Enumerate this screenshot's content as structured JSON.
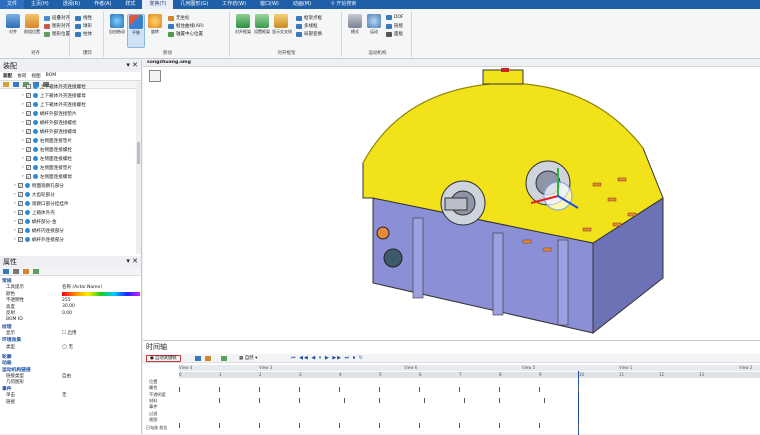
{
  "menu": {
    "file": "文件",
    "items": [
      "主页(H)",
      "透视(R)",
      "作者(A)",
      "样式",
      "变换(T)",
      "几何图形(G)",
      "工作坊(W)",
      "窗口(W)",
      "动画(M)"
    ],
    "search": "开始搜索"
  },
  "ribbon": {
    "g1": {
      "label": "对齐",
      "big": [
        "对齐",
        "前组位置"
      ],
      "small": [
        "层叠对齐",
        "图形对齐",
        "图形位置"
      ]
    },
    "g2": {
      "label": "爆炸",
      "small": [
        "线性",
        "球形",
        "柱体"
      ]
    },
    "g3": {
      "label": "移动",
      "big": [
        "自由拖动",
        "平移",
        "旋转"
      ],
      "small": [
        "无坐标",
        "框住曲线(AR)",
        "轴置中心位置"
      ]
    },
    "g4": {
      "label": "对开框架",
      "big": [
        "对开框架",
        "设置框架",
        "显示交叉线"
      ],
      "small": [
        "框架点框",
        "多线框",
        "局部变换"
      ]
    },
    "g5": {
      "label": "运动机构",
      "big": [
        "模式",
        "运动"
      ],
      "small": [
        "DOF",
        "链接",
        "面板"
      ]
    }
  },
  "assembly": {
    "title": "装配",
    "tabs": [
      "装配",
      "协同",
      "视图",
      "BOM"
    ],
    "items": [
      "上下箱体外壳连接螺栓",
      "上下箱体外壳连接螺母",
      "上下箱体外壳连接螺栓",
      "蜗杆外部连接垫片",
      "蜗杆外部连接螺栓",
      "蜗杆外部连接螺母",
      "右侧面连接垫片",
      "右侧面连接螺栓",
      "左侧面连接螺栓",
      "左侧面连接垫片",
      "左侧面连接螺母",
      "侧面观察孔部分",
      "大齿轮部分",
      "观察口部分挂挂件",
      "上箱体外壳",
      "蜗杆部分-金",
      "蜗杆内连接部分",
      "蜗杆外连接部分"
    ]
  },
  "properties": {
    "title": "属性",
    "cat_appearance": "常规",
    "tool_prompt_k": "工具提示",
    "tool_prompt_v": "名称 (Actor.Name)",
    "color_k": "颜色",
    "opacity_k": "不透明性",
    "opacity_v": "255",
    "brightness_k": "高度",
    "brightness_v": "30.00",
    "reflect_k": "反射",
    "reflect_v": "0.00",
    "bom_k": "BOM ID",
    "cat_texture": "纹理",
    "show_k": "显示",
    "show_v": "启用",
    "cat_env": "环境效果",
    "type_k": "类型",
    "type_v": "无",
    "cat_outline": "轮廓",
    "cat_anim": "动画",
    "cat_motion": "运动机构链接",
    "link_type_k": "链接类型",
    "link_type_v": "自由",
    "geo_k": "几何图形",
    "cat_event": "事件",
    "click_k": "单击",
    "click_v": "无",
    "link_k": "链接"
  },
  "viewport": {
    "tab": "songzhuang.smg"
  },
  "timeline": {
    "title": "时间轴",
    "record_btn": "自动关键帧",
    "playmode": "自然",
    "views": [
      "View 4",
      "View 3",
      "View 6",
      "View 5",
      "View 1",
      "View 2"
    ],
    "ticks": [
      "0",
      "1",
      "2",
      "3",
      "4",
      "5",
      "6",
      "7",
      "8",
      "9",
      "10",
      "11",
      "12",
      "13"
    ],
    "rows": [
      "位置",
      "属性",
      "不透明度",
      "材料",
      "事件",
      "过滤",
      "视图"
    ],
    "side": [
      "已勾选",
      "机位"
    ]
  }
}
